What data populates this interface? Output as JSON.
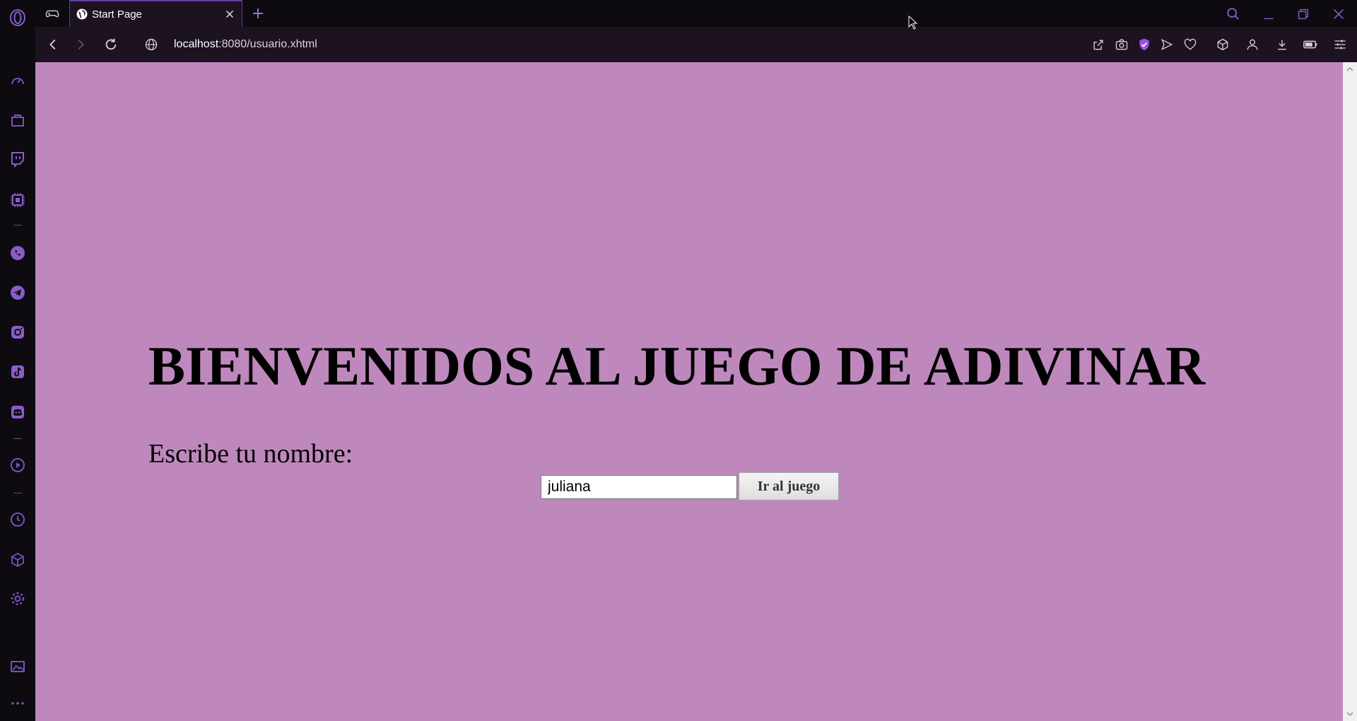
{
  "browser": {
    "tab": {
      "title": "Start Page"
    },
    "address_bar": {
      "host": "localhost",
      "path": ":8080/usuario.xhtml"
    }
  },
  "sidebar": {
    "items": [
      {
        "icon": "speed-dial-icon"
      },
      {
        "icon": "shopping-bag-icon"
      },
      {
        "icon": "twitch-icon"
      },
      {
        "icon": "aria-ai-icon"
      },
      {
        "icon": "whatsapp-icon"
      },
      {
        "icon": "telegram-icon"
      },
      {
        "icon": "instagram-icon"
      },
      {
        "icon": "tiktok-icon"
      },
      {
        "icon": "discord-icon"
      },
      {
        "icon": "player-icon"
      },
      {
        "icon": "history-icon"
      },
      {
        "icon": "extensions-cube-icon"
      },
      {
        "icon": "settings-gear-icon"
      },
      {
        "icon": "wallpaper-icon"
      },
      {
        "icon": "more-dots-icon"
      }
    ]
  },
  "page": {
    "heading": "BIENVENIDOS AL JUEGO DE ADIVINAR",
    "name_label": "Escribe tu nombre:",
    "name_input_value": "juliana",
    "submit_label": "Ir al juego",
    "background_color": "#bf88bd"
  },
  "theme": {
    "accent": "#9b4fe0",
    "chrome_bg": "#0d0a10",
    "toolbar_bg": "#1c1220"
  }
}
